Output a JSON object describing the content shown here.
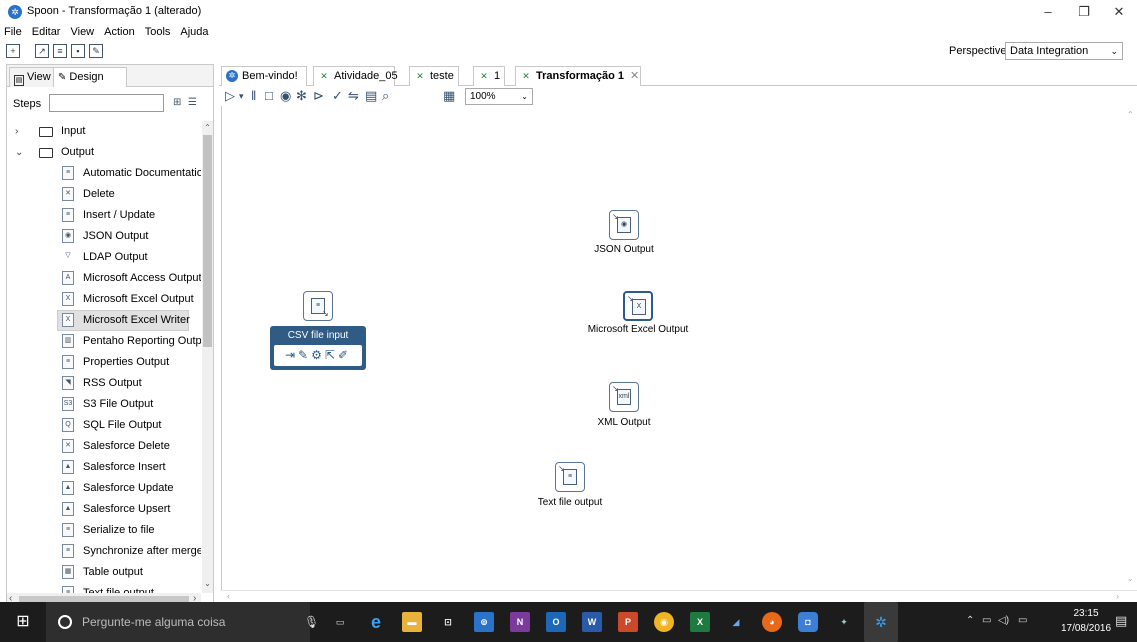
{
  "window": {
    "title": "Spoon - Transformação 1 (alterado)",
    "controls": [
      "–",
      "❐",
      "✕"
    ]
  },
  "menu": [
    "File",
    "Editar",
    "View",
    "Action",
    "Tools",
    "Ajuda"
  ],
  "perspective": {
    "label": "Perspective:",
    "value": "Data Integration"
  },
  "left_tabs": [
    {
      "label": "View"
    },
    {
      "label": "Design"
    }
  ],
  "steps_search": {
    "label": "Steps",
    "value": ""
  },
  "tree": {
    "folders": [
      {
        "label": "Input",
        "arrow": "›"
      },
      {
        "label": "Output",
        "arrow": "⌄"
      }
    ],
    "items": [
      "Automatic Documentation",
      "Delete",
      "Insert / Update",
      "JSON Output",
      "LDAP Output",
      "Microsoft Access Output",
      "Microsoft Excel Output",
      "Microsoft Excel Writer",
      "Pentaho Reporting Output",
      "Properties Output",
      "RSS Output",
      "S3 File Output",
      "SQL File Output",
      "Salesforce Delete",
      "Salesforce Insert",
      "Salesforce Update",
      "Salesforce Upsert",
      "Serialize to file",
      "Synchronize after merge",
      "Table output",
      "Text file output"
    ],
    "selected": "Microsoft Excel Writer"
  },
  "editor_tabs": [
    {
      "label": "Bem-vindo!",
      "icon": "spoon-icon"
    },
    {
      "label": "Atividade_05",
      "icon": "transformation-icon"
    },
    {
      "label": "teste",
      "icon": "transformation-icon"
    },
    {
      "label": "1",
      "icon": "transformation-icon"
    },
    {
      "label": "Transformação 1",
      "icon": "transformation-icon",
      "active": true
    }
  ],
  "zoom": "100%",
  "canvas_steps": {
    "json": "JSON Output",
    "excel": "Microsoft Excel Output",
    "xml": "XML Output",
    "text": "Text file output",
    "csv": "CSV file input"
  },
  "taskbar": {
    "search_placeholder": "Pergunte-me alguma coisa",
    "time": "23:15",
    "date": "17/08/2016"
  }
}
